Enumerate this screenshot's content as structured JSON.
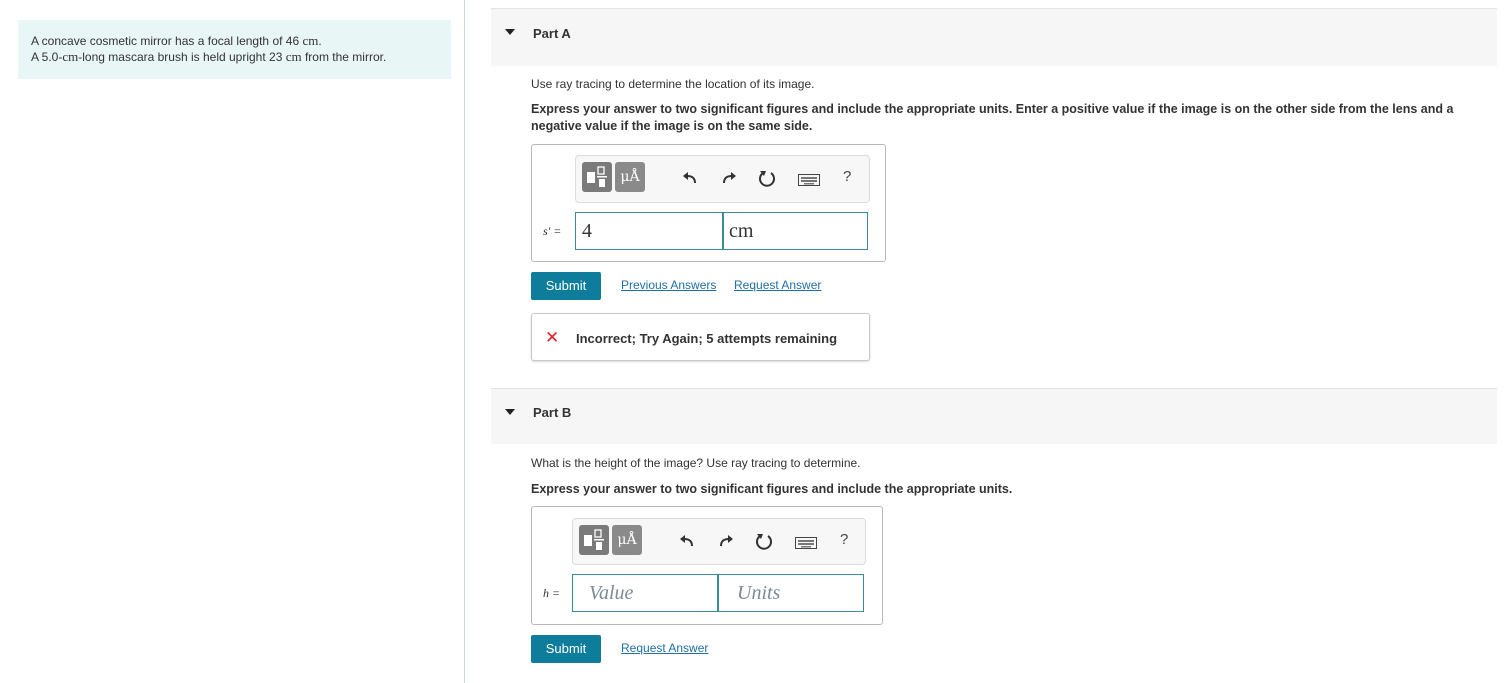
{
  "problem": {
    "line1_a": "A concave cosmetic mirror has a focal length of 46",
    "line1_unit": "cm",
    "line1_end": ".",
    "line2_a": "A 5.0-",
    "line2_unit1": "cm",
    "line2_b": "-long mascara brush is held upright 23",
    "line2_unit2": "cm",
    "line2_c": "from the mirror."
  },
  "part_a": {
    "title": "Part A",
    "question": "Use ray tracing to determine the location of its image.",
    "instructions": "Express your answer to two significant figures and include the appropriate units. Enter a positive value if the image is on the other side from the lens and a negative value if the image is on the same side.",
    "var_label": "s′ =",
    "value": "4",
    "units": "cm",
    "submit_label": "Submit",
    "previous_answers_label": "Previous Answers",
    "request_answer_label": "Request Answer",
    "feedback_text": "Incorrect; Try Again; 5 attempts remaining"
  },
  "part_b": {
    "title": "Part B",
    "question": "What is the height of the image? Use ray tracing to determine.",
    "instructions": "Express your answer to two significant figures and include the appropriate units.",
    "var_label": "h =",
    "value_placeholder": "Value",
    "units_placeholder": "Units",
    "submit_label": "Submit",
    "request_answer_label": "Request Answer"
  },
  "toolbar": {
    "mu_label": "μÅ",
    "help_label": "?"
  },
  "colors": {
    "accent": "#0e7c9b",
    "link": "#1f6fa8",
    "error": "#e0202a",
    "problem_bg": "#e8f6f6"
  }
}
